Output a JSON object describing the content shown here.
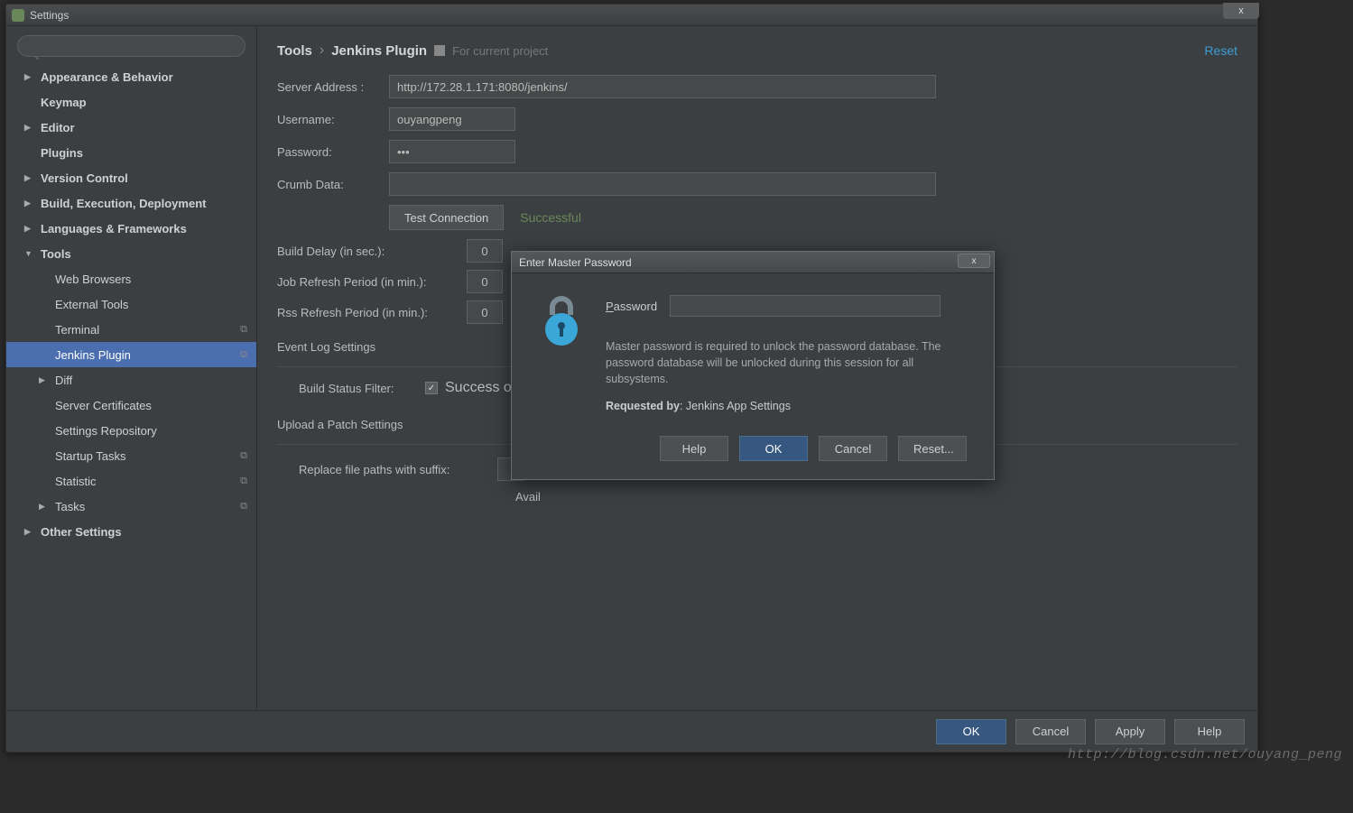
{
  "window": {
    "title": "Settings",
    "close": "x"
  },
  "search": {
    "placeholder": ""
  },
  "sidebar": {
    "items": [
      {
        "label": "Appearance & Behavior",
        "caret": "▶",
        "bold": true
      },
      {
        "label": "Keymap",
        "caret": "",
        "bold": true
      },
      {
        "label": "Editor",
        "caret": "▶",
        "bold": true
      },
      {
        "label": "Plugins",
        "caret": "",
        "bold": true
      },
      {
        "label": "Version Control",
        "caret": "▶",
        "bold": true
      },
      {
        "label": "Build, Execution, Deployment",
        "caret": "▶",
        "bold": true
      },
      {
        "label": "Languages & Frameworks",
        "caret": "▶",
        "bold": true
      },
      {
        "label": "Tools",
        "caret": "▼",
        "bold": true
      },
      {
        "label": "Web Browsers",
        "child": true
      },
      {
        "label": "External Tools",
        "child": true
      },
      {
        "label": "Terminal",
        "child": true,
        "icon": true
      },
      {
        "label": "Jenkins Plugin",
        "child": true,
        "icon": true,
        "selected": true
      },
      {
        "label": "Diff",
        "child": true,
        "caret": "▶"
      },
      {
        "label": "Server Certificates",
        "child": true
      },
      {
        "label": "Settings Repository",
        "child": true
      },
      {
        "label": "Startup Tasks",
        "child": true,
        "icon": true
      },
      {
        "label": "Statistic",
        "child": true,
        "icon": true
      },
      {
        "label": "Tasks",
        "caret": "▶",
        "child2": true
      },
      {
        "label": "Other Settings",
        "caret": "▶",
        "bold": true
      }
    ]
  },
  "breadcrumb": {
    "a": "Tools",
    "b": "Jenkins Plugin",
    "hint": "For current project",
    "reset": "Reset"
  },
  "form": {
    "server_label": "Server Address :",
    "server_value": "http://172.28.1.171:8080/jenkins/",
    "username_label": "Username:",
    "username_value": "ouyangpeng",
    "password_label": "Password:",
    "password_value": "•••",
    "crumb_label": "Crumb Data:",
    "crumb_value": "",
    "test_btn": "Test Connection",
    "test_status": "Successful",
    "build_delay_label": "Build Delay (in sec.):",
    "build_delay_value": "0",
    "job_refresh_label": "Job Refresh Period (in min.):",
    "job_refresh_value": "0",
    "rss_refresh_label": "Rss Refresh Period (in min.):",
    "rss_refresh_value": "0",
    "event_log_label": "Event Log Settings",
    "build_status_filter_label": "Build Status Filter:",
    "build_status_filter_text": "Success or",
    "upload_label": "Upload a Patch Settings",
    "replace_label": "Replace file paths with suffix:",
    "avail_text": "Avail"
  },
  "bottom": {
    "ok": "OK",
    "cancel": "Cancel",
    "apply": "Apply",
    "help": "Help"
  },
  "dialog": {
    "title": "Enter Master Password",
    "close": "x",
    "password_label": "Password",
    "body_text": "Master password is required to unlock the password database. The password database will be unlocked during this session for all subsystems.",
    "requested_by_label": "Requested by",
    "requested_by_value": ": Jenkins App Settings",
    "help": "Help",
    "ok": "OK",
    "cancel": "Cancel",
    "reset": "Reset..."
  },
  "watermark": "http://blog.csdn.net/ouyang_peng"
}
